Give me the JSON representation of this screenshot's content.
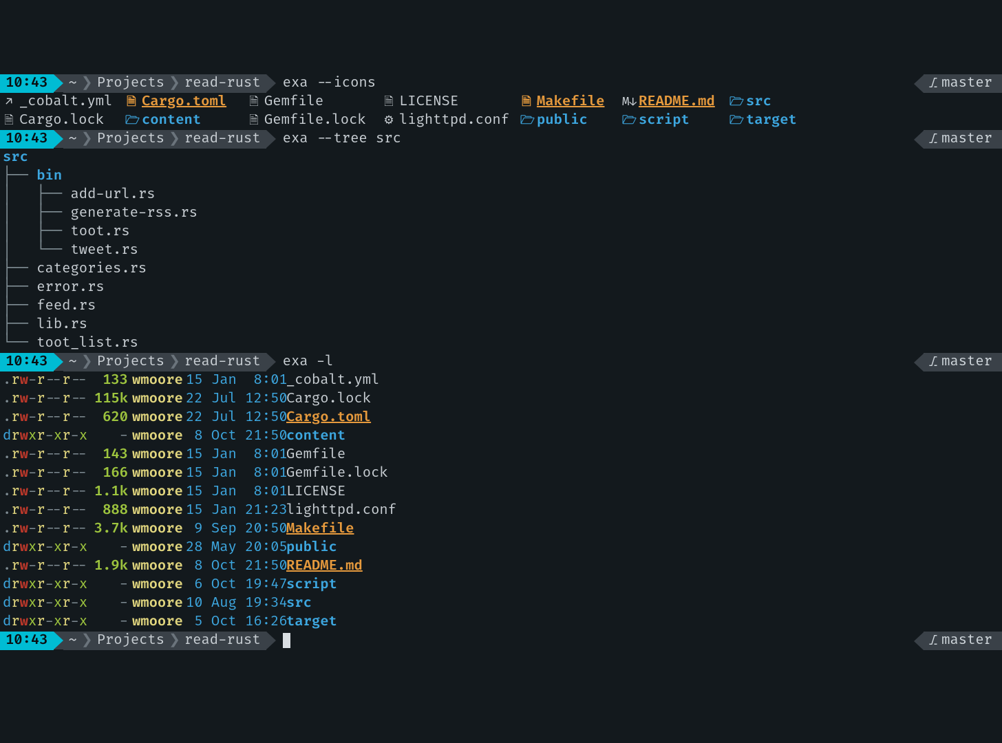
{
  "prompt": {
    "time": "10:43",
    "home": "~",
    "path1": "Projects",
    "path2": "read-rust",
    "branch": "master"
  },
  "cmds": {
    "icons": "exa --icons",
    "tree": "exa --tree src",
    "long": "exa -l",
    "empty": ""
  },
  "icons_listing": {
    "row0": [
      {
        "icon": "↗",
        "name": "_cobalt.yml",
        "cls": "fg-fg"
      },
      {
        "icon": "🗎",
        "name": "Cargo.toml",
        "cls": "fg-orange-u",
        "icls": "fg-orange"
      },
      {
        "icon": "🗎",
        "name": "Gemfile",
        "cls": "fg-fg"
      },
      {
        "icon": "🗎",
        "name": "LICENSE",
        "cls": "fg-fg"
      },
      {
        "icon": "🗎",
        "name": "Makefile",
        "cls": "fg-orange-u",
        "icls": "fg-orange"
      },
      {
        "icon": "M↓",
        "name": "README.md",
        "cls": "fg-orange-u",
        "icls": "fg-fg"
      },
      {
        "icon": "🗁",
        "name": "src",
        "cls": "fg-blue",
        "icls": "fg-blue"
      }
    ],
    "row1": [
      {
        "icon": "🗎",
        "name": "Cargo.lock",
        "cls": "fg-fg"
      },
      {
        "icon": "🗁",
        "name": "content",
        "cls": "fg-blue",
        "icls": "fg-blue"
      },
      {
        "icon": "🗎",
        "name": "Gemfile.lock",
        "cls": "fg-fg"
      },
      {
        "icon": "⚙",
        "name": "lighttpd.conf",
        "cls": "fg-fg"
      },
      {
        "icon": "🗁",
        "name": "public",
        "cls": "fg-blue",
        "icls": "fg-blue"
      },
      {
        "icon": "🗁",
        "name": "script",
        "cls": "fg-blue",
        "icls": "fg-blue"
      },
      {
        "icon": "🗁",
        "name": "target",
        "cls": "fg-blue",
        "icls": "fg-blue"
      }
    ]
  },
  "tree": [
    {
      "prefix": "",
      "name": "src",
      "dir": true
    },
    {
      "prefix": "├── ",
      "name": "bin",
      "dir": true
    },
    {
      "prefix": "│   ├── ",
      "name": "add-url.rs",
      "dir": false
    },
    {
      "prefix": "│   ├── ",
      "name": "generate-rss.rs",
      "dir": false
    },
    {
      "prefix": "│   ├── ",
      "name": "toot.rs",
      "dir": false
    },
    {
      "prefix": "│   └── ",
      "name": "tweet.rs",
      "dir": false
    },
    {
      "prefix": "├── ",
      "name": "categories.rs",
      "dir": false
    },
    {
      "prefix": "├── ",
      "name": "error.rs",
      "dir": false
    },
    {
      "prefix": "├── ",
      "name": "feed.rs",
      "dir": false
    },
    {
      "prefix": "├── ",
      "name": "lib.rs",
      "dir": false
    },
    {
      "prefix": "└── ",
      "name": "toot_list.rs",
      "dir": false
    }
  ],
  "long": [
    {
      "perm": ".rw-r--r--",
      "size": "133",
      "user": "wmoore",
      "date": "15 Jan  8:01",
      "name": "_cobalt.yml",
      "ncls": "fname-fg"
    },
    {
      "perm": ".rw-r--r--",
      "size": "115k",
      "user": "wmoore",
      "date": "22 Jul 12:50",
      "name": "Cargo.lock",
      "ncls": "fname-fg"
    },
    {
      "perm": ".rw-r--r--",
      "size": "620",
      "user": "wmoore",
      "date": "22 Jul 12:50",
      "name": "Cargo.toml",
      "ncls": "fname-ou"
    },
    {
      "perm": "drwxr-xr-x",
      "size": "-",
      "user": "wmoore",
      "date": " 8 Oct 21:50",
      "name": "content",
      "ncls": "fname-blue"
    },
    {
      "perm": ".rw-r--r--",
      "size": "143",
      "user": "wmoore",
      "date": "15 Jan  8:01",
      "name": "Gemfile",
      "ncls": "fname-fg"
    },
    {
      "perm": ".rw-r--r--",
      "size": "166",
      "user": "wmoore",
      "date": "15 Jan  8:01",
      "name": "Gemfile.lock",
      "ncls": "fname-fg"
    },
    {
      "perm": ".rw-r--r--",
      "size": "1.1k",
      "user": "wmoore",
      "date": "15 Jan  8:01",
      "name": "LICENSE",
      "ncls": "fname-fg"
    },
    {
      "perm": ".rw-r--r--",
      "size": "888",
      "user": "wmoore",
      "date": "15 Jan 21:23",
      "name": "lighttpd.conf",
      "ncls": "fname-fg"
    },
    {
      "perm": ".rw-r--r--",
      "size": "3.7k",
      "user": "wmoore",
      "date": " 9 Sep 20:50",
      "name": "Makefile",
      "ncls": "fname-ou"
    },
    {
      "perm": "drwxr-xr-x",
      "size": "-",
      "user": "wmoore",
      "date": "28 May 20:05",
      "name": "public",
      "ncls": "fname-blue"
    },
    {
      "perm": ".rw-r--r--",
      "size": "1.9k",
      "user": "wmoore",
      "date": " 8 Oct 21:50",
      "name": "README.md",
      "ncls": "fname-ou"
    },
    {
      "perm": "drwxr-xr-x",
      "size": "-",
      "user": "wmoore",
      "date": " 6 Oct 19:47",
      "name": "script",
      "ncls": "fname-blue"
    },
    {
      "perm": "drwxr-xr-x",
      "size": "-",
      "user": "wmoore",
      "date": "10 Aug 19:34",
      "name": "src",
      "ncls": "fname-blue"
    },
    {
      "perm": "drwxr-xr-x",
      "size": "-",
      "user": "wmoore",
      "date": " 5 Oct 16:26",
      "name": "target",
      "ncls": "fname-blue"
    }
  ]
}
